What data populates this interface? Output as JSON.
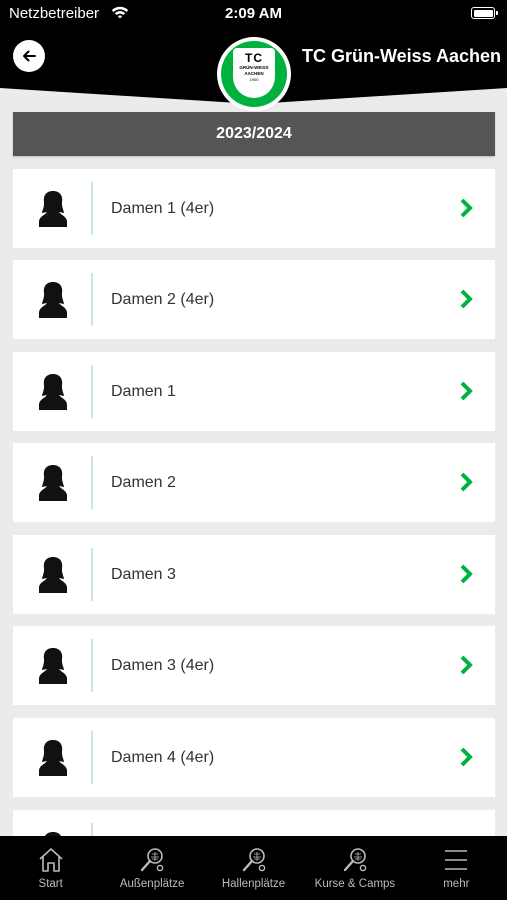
{
  "status_bar": {
    "carrier": "Netzbetreiber",
    "time": "2:09 AM"
  },
  "header": {
    "title": "TC Grün-Weiss Aachen",
    "back_icon": "arrow-left-icon",
    "logo": {
      "initials": "TC",
      "name_line1": "GRÜN-WEISS",
      "name_line2": "AACHEN",
      "year": "1900"
    }
  },
  "colors": {
    "accent": "#00b140",
    "header_bg": "#000000",
    "season_bar_bg": "#555555",
    "page_bg": "#ebebeb"
  },
  "season": "2023/2024",
  "teams": [
    {
      "name": "Damen 1 (4er)"
    },
    {
      "name": "Damen 2 (4er)"
    },
    {
      "name": "Damen 1"
    },
    {
      "name": "Damen 2"
    },
    {
      "name": "Damen 3"
    },
    {
      "name": "Damen 3 (4er)"
    },
    {
      "name": "Damen 4 (4er)"
    },
    {
      "name": ""
    }
  ],
  "tabs": [
    {
      "label": "Start",
      "icon": "home-icon"
    },
    {
      "label": "Außenplätze",
      "icon": "tennis-racket-icon"
    },
    {
      "label": "Hallenplätze",
      "icon": "tennis-racket-icon"
    },
    {
      "label": "Kurse & Camps",
      "icon": "tennis-racket-icon"
    },
    {
      "label": "mehr",
      "icon": "menu-icon"
    }
  ]
}
